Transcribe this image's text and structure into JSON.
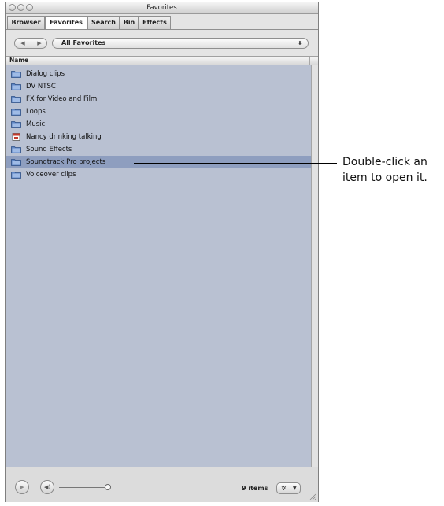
{
  "window": {
    "title": "Favorites"
  },
  "tabs": [
    {
      "label": "Browser",
      "active": false
    },
    {
      "label": "Favorites",
      "active": true
    },
    {
      "label": "Search",
      "active": false
    },
    {
      "label": "Bin",
      "active": false
    },
    {
      "label": "Effects",
      "active": false
    }
  ],
  "navigation": {
    "back_icon": "back-arrow-icon",
    "forward_icon": "forward-arrow-icon",
    "location_popup": "All Favorites"
  },
  "list": {
    "column_header": "Name",
    "items": [
      {
        "label": "Dialog clips",
        "icon": "folder-icon",
        "selected": false
      },
      {
        "label": "DV NTSC",
        "icon": "folder-icon",
        "selected": false
      },
      {
        "label": "FX for Video and Film",
        "icon": "folder-icon",
        "selected": false
      },
      {
        "label": "Loops",
        "icon": "folder-icon",
        "selected": false
      },
      {
        "label": "Music",
        "icon": "folder-icon",
        "selected": false
      },
      {
        "label": "Nancy drinking talking",
        "icon": "media-file-icon",
        "selected": false
      },
      {
        "label": "Sound Effects",
        "icon": "folder-icon",
        "selected": false
      },
      {
        "label": "Soundtrack Pro projects",
        "icon": "folder-icon",
        "selected": true
      },
      {
        "label": "Voiceover clips",
        "icon": "folder-icon",
        "selected": false
      }
    ]
  },
  "footer": {
    "item_count": "9 items",
    "play_icon": "play-icon",
    "volume_icon": "speaker-icon",
    "action_icon": "gear-icon"
  },
  "callout": {
    "line1": "Double-click an",
    "line2": "item to open it."
  },
  "colors": {
    "list_background": "#b9c1d2",
    "selection": "#8e9ebf",
    "folder_blue": "#5f86c4"
  }
}
